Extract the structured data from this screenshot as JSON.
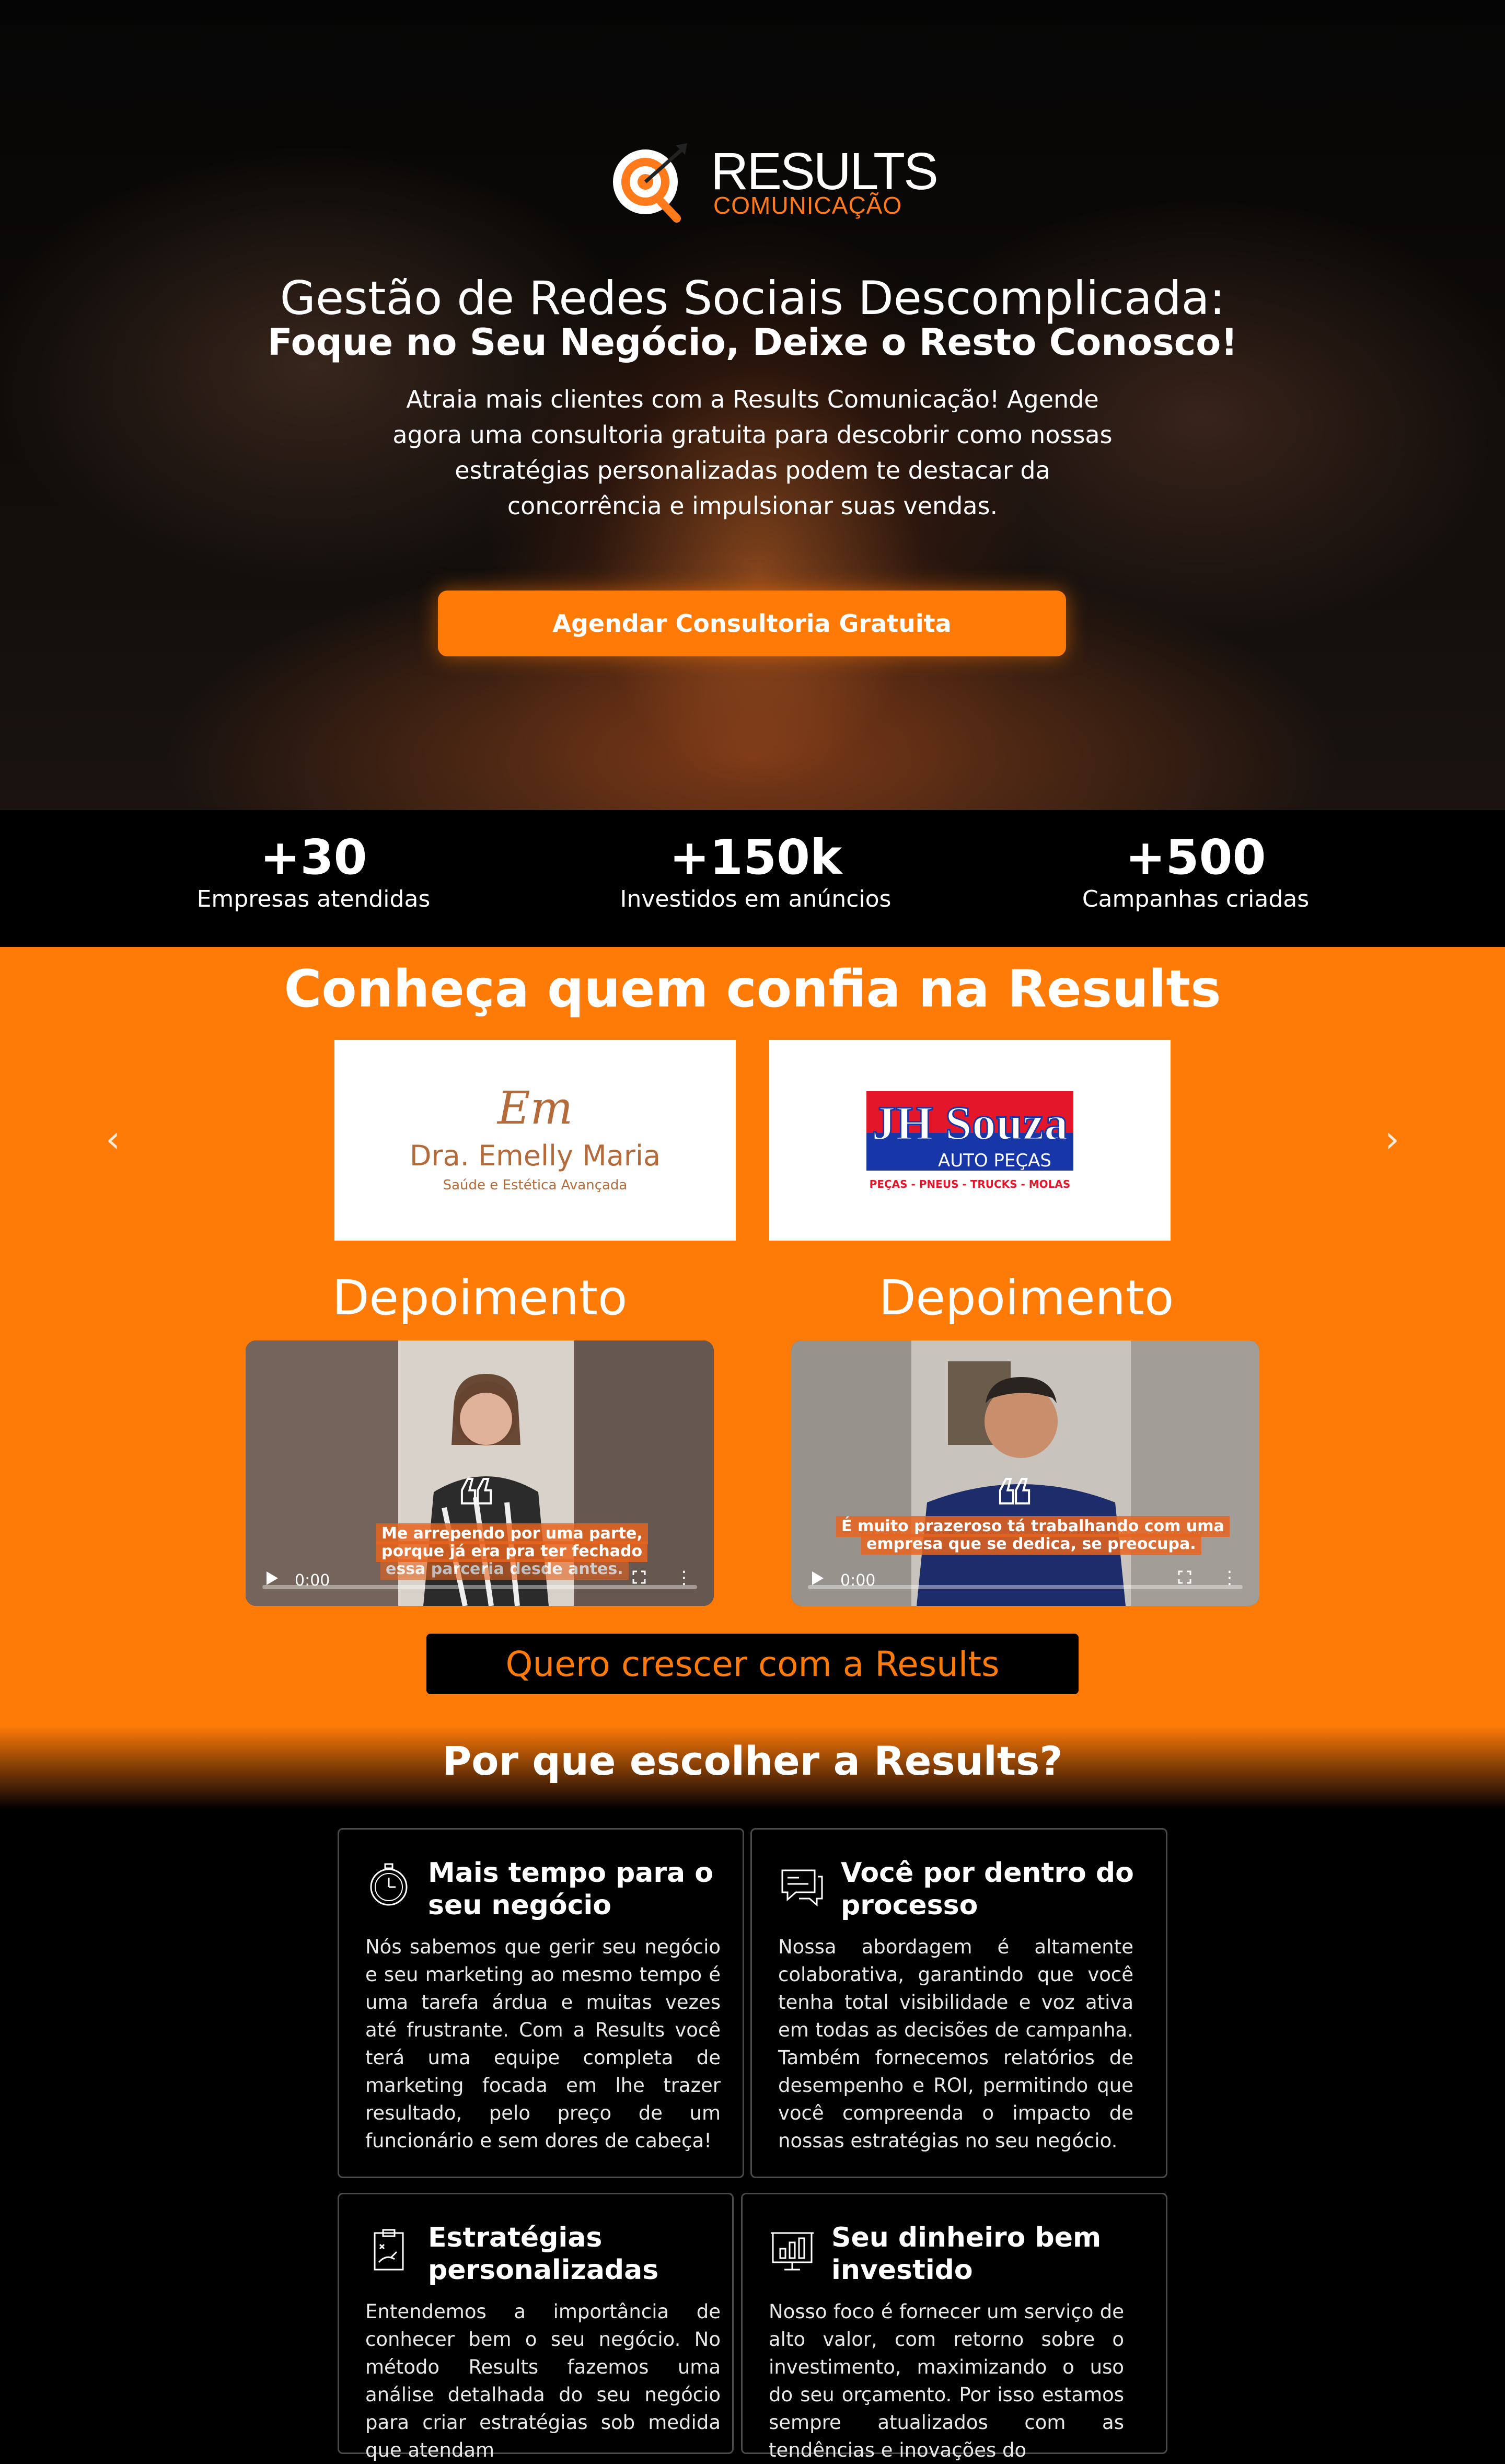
{
  "logo": {
    "word": "RESULTS",
    "sub": "COMUNICAÇÃO"
  },
  "hero": {
    "title_line1": "Gestão de Redes Sociais Descomplicada:",
    "title_line2": "Foque no Seu Negócio, Deixe o Resto Conosco!",
    "description": "Atraia mais clientes com a Results Comunicação! Agende agora uma consultoria gratuita para descobrir como nossas estratégias personalizadas podem te destacar da concorrência e impulsionar suas vendas.",
    "cta_label": "Agendar Consultoria Gratuita"
  },
  "stats": [
    {
      "value": "+30",
      "label": "Empresas atendidas"
    },
    {
      "value": "+150k",
      "label": "Investidos em anúncios"
    },
    {
      "value": "+500",
      "label": "Campanhas criadas"
    }
  ],
  "clients": {
    "title": "Conheça quem confia na Results",
    "logos": [
      {
        "monogram": "Em",
        "name": "Dra. Emelly Maria",
        "tagline": "Saúde e Estética Avançada"
      },
      {
        "name": "JH Souza",
        "sub": "AUTO PEÇAS",
        "tagline": "PEÇAS - PNEUS - TRUCKS - MOLAS"
      }
    ],
    "prev_icon": "chevron-left-icon",
    "next_icon": "chevron-right-icon"
  },
  "testimonials": [
    {
      "title": "Depoimento",
      "caption_line1": "Me arrependo por uma parte,",
      "caption_line2": "porque já era pra ter fechado",
      "caption_line3": "essa parceria desde antes.",
      "time": "0:00"
    },
    {
      "title": "Depoimento",
      "caption_line1": "É muito prazeroso tá trabalhando com uma",
      "caption_line2": "empresa que se dedica, se preocupa.",
      "time": "0:00"
    }
  ],
  "cta_secondary": "Quero crescer com a Results",
  "why": {
    "title": "Por que escolher a Results?",
    "features": [
      {
        "icon": "stopwatch-icon",
        "title": "Mais tempo para o seu negócio",
        "text": "Nós sabemos que gerir seu negócio e seu marketing ao mesmo tempo é uma tarefa árdua e muitas vezes até frustrante. Com a Results você terá uma equipe completa de marketing focada em lhe trazer resultado, pelo preço de um funcionário e sem dores de cabeça!"
      },
      {
        "icon": "chat-icon",
        "title": "Você por dentro do processo",
        "text": "Nossa abordagem é altamente colaborativa, garantindo que você tenha total visibilidade e voz ativa em todas as decisões de campanha. Também fornecemos relatórios de desempenho e ROI, permitindo que você compreenda o impacto de nossas estratégias no seu negócio."
      },
      {
        "icon": "clipboard-strategy-icon",
        "title": "Estratégias personalizadas",
        "text": "Entendemos a importância de conhecer bem o seu negócio. No método Results fazemos uma análise detalhada do seu negócio para criar estratégias sob medida que atendam"
      },
      {
        "icon": "bar-chart-board-icon",
        "title": "Seu dinheiro bem investido",
        "text": "Nosso foco é fornecer um serviço de alto valor, com retorno sobre o investimento, maximizando o uso do seu orçamento. Por isso estamos sempre atualizados com as tendências e inovações do"
      }
    ]
  },
  "colors": {
    "accent": "#ff7b08",
    "background": "#000000"
  }
}
